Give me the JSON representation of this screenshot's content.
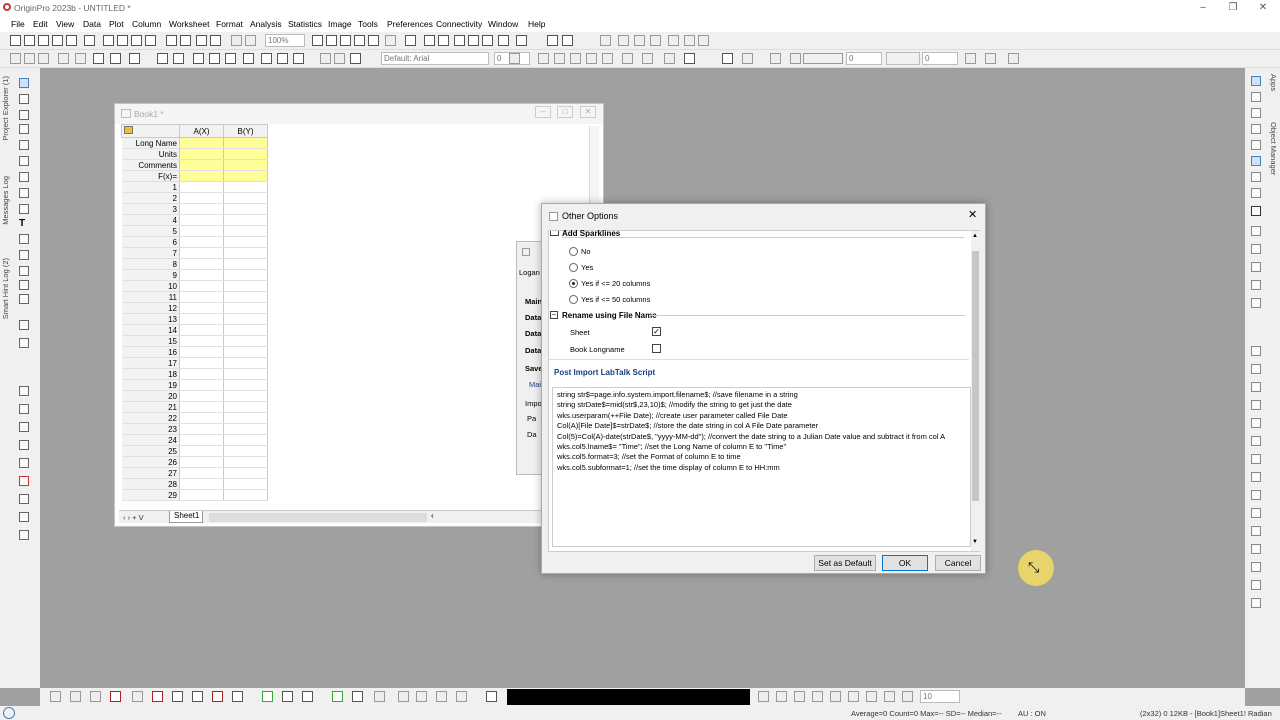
{
  "app": {
    "title": "OriginPro 2023b - UNTITLED *"
  },
  "menu": [
    "File",
    "Edit",
    "View",
    "Data",
    "Plot",
    "Column",
    "Worksheet",
    "Format",
    "Analysis",
    "Statistics",
    "Image",
    "Tools",
    "Preferences",
    "Connectivity",
    "Window",
    "Help"
  ],
  "toolbar": {
    "zoom": "100%",
    "font": "Default: Arial",
    "font_size": "0",
    "line_width": "0",
    "size2": "0",
    "bottom_size": "10"
  },
  "sidebar": {
    "left_tabs": [
      "Project Explorer (1)",
      "Messages Log",
      "Smart Hint Log (2)"
    ],
    "right_tabs": [
      "Apps",
      "Object Manager"
    ]
  },
  "book": {
    "title": "Book1 *",
    "columns": [
      "A(X)",
      "B(Y)"
    ],
    "label_rows": [
      "Long Name",
      "Units",
      "Comments",
      "F(x)="
    ],
    "rows": [
      "1",
      "2",
      "3",
      "4",
      "5",
      "6",
      "7",
      "8",
      "9",
      "10",
      "11",
      "12",
      "13",
      "14",
      "15",
      "16",
      "17",
      "18",
      "19",
      "20",
      "21",
      "22",
      "23",
      "24",
      "25",
      "26",
      "27",
      "28",
      "29"
    ],
    "sheet_tab": "Sheet1"
  },
  "behind_dialog": {
    "items": [
      "Logan",
      "Main",
      "Data",
      "Data",
      "Data",
      "Save",
      "Main",
      "Impo",
      "Pa",
      "Da"
    ]
  },
  "dialog": {
    "title": "Other Options",
    "section_sparklines": "Add Sparklines",
    "sparkline_options": [
      "No",
      "Yes",
      "Yes if <= 20 columns",
      "Yes if <= 50 columns"
    ],
    "section_rename": "Rename using File Name",
    "rename_sheet_label": "Sheet",
    "rename_book_label": "Book Longname",
    "script_label": "Post Import LabTalk Script",
    "script_lines": [
      "string str$=page.info.system.import.filename$; //save filename in a string",
      "string strDate$=mid(str$,23,10)$; //modify the string to get just the date",
      "wks.userparam(++File Date); //create user parameter called File Date",
      "Col(A)[File Date]$=strDate$; //store the date string in col A File Date parameter",
      "Col(5)=Col(A)-date(strDate$, \"yyyy-MM-dd\"); //convert the date string to a Julian Date value and subtract it from col A",
      "wks.col5.lname$= \"Time\"; //set the Long Name of column E to \"Time\"",
      "wks.col5.format=3; //set the Format of column E to time",
      "wks.col5.subformat=1; //set the time display of column E to HH:mm"
    ],
    "buttons": {
      "set_default": "Set as Default",
      "ok": "OK",
      "cancel": "Cancel"
    }
  },
  "status": {
    "left": "Average=0 Count=0 Max=-- SD=-- Median=--",
    "au": "AU : ON",
    "right": "(2x32) 0   12KB - [Book1]Sheet1!   Radian"
  }
}
